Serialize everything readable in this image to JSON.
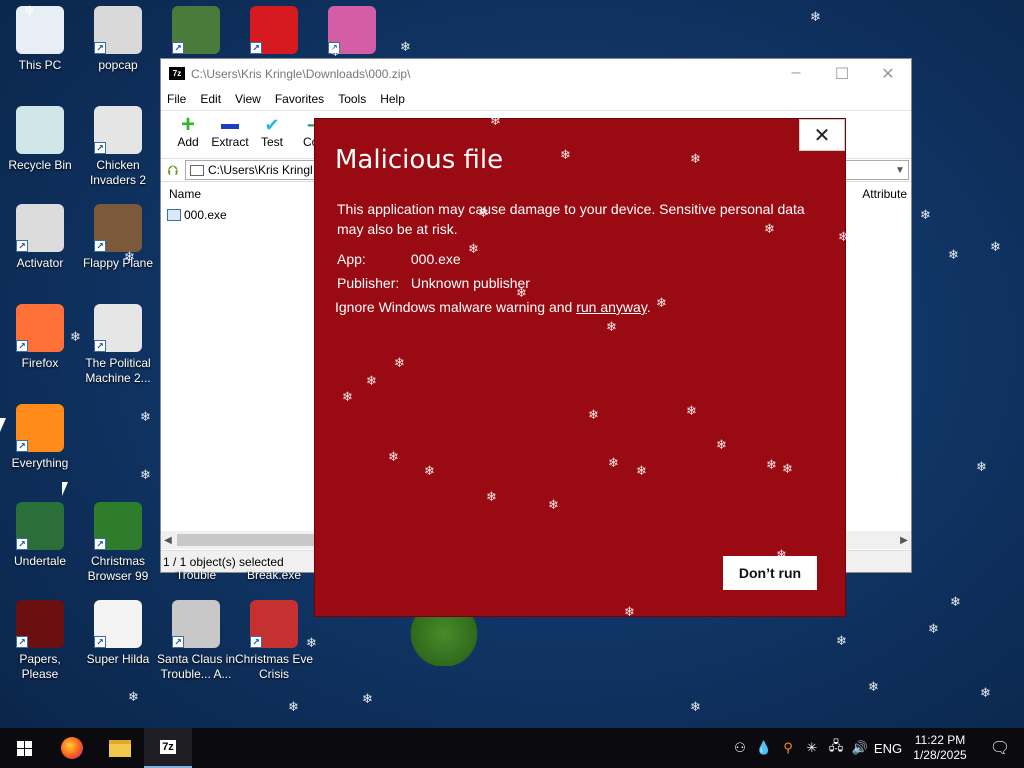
{
  "desktop": {
    "icons": [
      {
        "label": "This PC",
        "icon": "computer-icon",
        "color": "#e8eef5"
      },
      {
        "label": "popcap",
        "icon": "popcap-icon",
        "color": "#d9d9d9"
      },
      {
        "label": "",
        "icon": "anime-game-icon",
        "color": "#4a7b3a"
      },
      {
        "label": "",
        "icon": "mcdonalds-icon",
        "color": "#d71920"
      },
      {
        "label": "",
        "icon": "pig-game-icon",
        "color": "#d35ea6"
      },
      {
        "label": "Recycle Bin",
        "icon": "recycle-bin-icon",
        "color": "#cfe7e9"
      },
      {
        "label": "Chicken Invaders 2",
        "icon": "chicken-invaders-icon",
        "color": "#e5e5e5"
      },
      {
        "label": "Activator",
        "icon": "activator-icon",
        "color": "#dcdcdc"
      },
      {
        "label": "Flappy Plane",
        "icon": "flappy-plane-icon",
        "color": "#7a5a3a"
      },
      {
        "label": "Firefox",
        "icon": "firefox-icon",
        "color": "#ff7139"
      },
      {
        "label": "The Political Machine 2...",
        "icon": "political-machine-icon",
        "color": "#e6e6e6"
      },
      {
        "label": "Everything",
        "icon": "everything-search-icon",
        "color": "#ff8c1a"
      },
      {
        "label": "Undertale",
        "icon": "undertale-icon",
        "color": "#2a6f3a"
      },
      {
        "label": "Christmas Browser 99",
        "icon": "christmas-tree-icon",
        "color": "#2d7d2d"
      },
      {
        "label": "Papers, Please",
        "icon": "papers-please-icon",
        "color": "#6a1010"
      },
      {
        "label": "Super Hilda",
        "icon": "super-hilda-icon",
        "color": "#f3f3f3"
      },
      {
        "label": "Santa Claus in Trouble... A...",
        "icon": "santa-claus-icon",
        "color": "#c8c8c8"
      },
      {
        "label": "Christmas Eve Crisis",
        "icon": "santa-face-icon",
        "color": "#c53030"
      }
    ],
    "hidden_labels": [
      "Trouble",
      "Break.exe"
    ]
  },
  "zip_window": {
    "title": "C:\\Users\\Kris Kringle\\Downloads\\000.zip\\",
    "logo": "7z",
    "menu": [
      "File",
      "Edit",
      "View",
      "Favorites",
      "Tools",
      "Help"
    ],
    "toolbar": [
      {
        "label": "Add",
        "icon": "plus-icon",
        "color": "#2fb52f"
      },
      {
        "label": "Extract",
        "icon": "minus-icon",
        "color": "#1a3fbf"
      },
      {
        "label": "Test",
        "icon": "check-icon",
        "color": "#2bb7d6"
      },
      {
        "label": "Cop",
        "icon": "copy-icon",
        "color": "#2a9a6a"
      }
    ],
    "address": "C:\\Users\\Kris Kringl",
    "columns": {
      "name": "Name",
      "attributes": "Attribute"
    },
    "files": [
      {
        "name": "000.exe"
      }
    ],
    "status": "1 / 1 object(s) selected"
  },
  "dialog": {
    "title": "Malicious file",
    "message": "This application may cause damage to your device. Sensitive personal data may also be at risk.",
    "app_label": "App:",
    "app_value": "000.exe",
    "publisher_label": "Publisher:",
    "publisher_value": "Unknown publisher",
    "ignore_text": "Ignore Windows malware warning and ",
    "run_anyway": "run anyway",
    "ignore_suffix": ".",
    "dont_run": "Don’t run",
    "background_color": "#9a0a12"
  },
  "taskbar": {
    "apps": [
      "start-icon",
      "firefox-icon",
      "file-explorer-icon",
      "7zip-icon"
    ],
    "app_7z": "7z",
    "language": "ENG",
    "time": "11:22 PM",
    "date": "1/28/2025"
  }
}
